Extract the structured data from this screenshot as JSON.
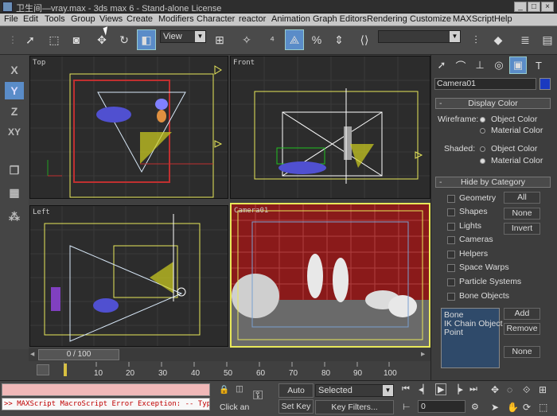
{
  "window": {
    "title": "卫生间—vray.max - 3ds max 6 - Stand-alone License",
    "minimize": "_",
    "maximize": "□",
    "close": "×"
  },
  "menu": [
    "File",
    "Edit",
    "Tools",
    "Group",
    "Views",
    "Create",
    "Modifiers",
    "Character",
    "reactor",
    "Animation",
    "Graph Editors",
    "Rendering",
    "Customize",
    "MAXScript",
    "Help"
  ],
  "toolbar": {
    "refcoord": "View",
    "selection_set": ""
  },
  "axis_constraints": [
    "X",
    "Y",
    "Z",
    "XY"
  ],
  "viewports": {
    "top": "Top",
    "front": "Front",
    "left": "Left",
    "camera": "Camera01"
  },
  "command_panel": {
    "object_name": "Camera01",
    "display_color": {
      "header": "Display Color",
      "wireframe_label": "Wireframe:",
      "shaded_label": "Shaded:",
      "object_color": "Object Color",
      "material_color": "Material Color"
    },
    "hide_by_category": {
      "header": "Hide by Category",
      "items": [
        "Geometry",
        "Shapes",
        "Lights",
        "Cameras",
        "Helpers",
        "Space Warps",
        "Particle Systems",
        "Bone Objects"
      ],
      "all": "All",
      "none": "None",
      "invert": "Invert"
    },
    "list": [
      "Bone",
      "IK Chain Object",
      "Point"
    ],
    "add": "Add",
    "remove": "Remove",
    "none2": "None"
  },
  "timeline": {
    "frame": "0 / 100",
    "ticks": [
      "10",
      "20",
      "30",
      "40",
      "50",
      "60",
      "70",
      "80",
      "90",
      "100"
    ]
  },
  "status": {
    "maxscript": ">> MAXScript MacroScript Error Exception: -- Type",
    "click_hint": "Click an",
    "auto_key": "Auto Key",
    "set_key": "Set Key",
    "selected": "Selected",
    "key_filters": "Key Filters...",
    "frame_field": "0"
  },
  "colors": {
    "accent": "#5a8cc8",
    "grid": "#3a3a3a",
    "wire_yellow": "#e8e85a",
    "wall_red": "#8a1a1a"
  }
}
